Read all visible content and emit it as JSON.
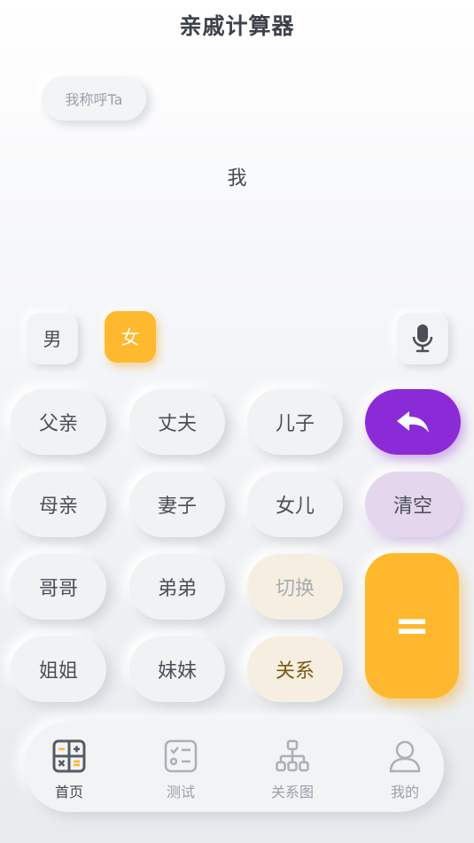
{
  "app": {
    "title": "亲戚计算器"
  },
  "mode_chip": {
    "label": "我称呼Ta"
  },
  "display": {
    "expression": "我"
  },
  "gender": {
    "male": "男",
    "female": "女",
    "selected": "女"
  },
  "mic": {
    "icon": "microphone-icon"
  },
  "keys": {
    "row1": [
      "父亲",
      "丈夫",
      "儿子"
    ],
    "row2": [
      "母亲",
      "妻子",
      "女儿"
    ],
    "row3": [
      "哥哥",
      "弟弟",
      "切换"
    ],
    "row4": [
      "姐姐",
      "妹妹",
      "关系"
    ],
    "back_icon": "reply-arrow-icon",
    "clear": "清空",
    "equals": "="
  },
  "nav": {
    "items": [
      {
        "label": "首页",
        "icon": "calculator-icon",
        "active": true
      },
      {
        "label": "测试",
        "icon": "checklist-icon",
        "active": false
      },
      {
        "label": "关系图",
        "icon": "org-chart-icon",
        "active": false
      },
      {
        "label": "我的",
        "icon": "user-icon",
        "active": false
      }
    ]
  },
  "colors": {
    "accent_orange": "#ffb82e",
    "accent_purple": "#8b2bd8",
    "clear_lilac": "#e4d6ec",
    "beige_key": "#f6efe1"
  }
}
